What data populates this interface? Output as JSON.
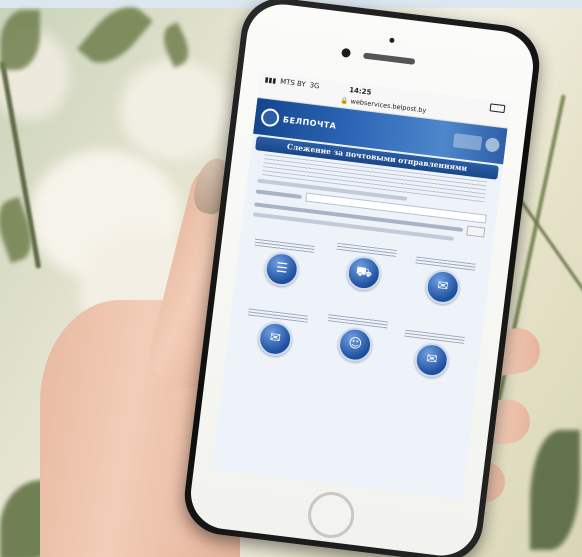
{
  "photo": {
    "status": {
      "carrier": "MTS BY",
      "network": "3G",
      "time": "14:25"
    },
    "url": "webservices.belpost.by",
    "site": {
      "logo_text": "БЕЛПОЧТА",
      "page_title": "Слежение за почтовыми отправлениями"
    },
    "services": [
      {
        "icon": "document-list-icon",
        "glyph": "☰"
      },
      {
        "icon": "truck-icon",
        "glyph": "⛟"
      },
      {
        "icon": "envelope-icon",
        "glyph": "✉"
      },
      {
        "icon": "envelope-icon",
        "glyph": "✉"
      },
      {
        "icon": "courier-icon",
        "glyph": "☺"
      },
      {
        "icon": "mail-open-icon",
        "glyph": "✉"
      }
    ],
    "colors": {
      "site_blue": "#1b4688",
      "phone_body": "#111111",
      "skin": "#f0c9b2"
    }
  }
}
